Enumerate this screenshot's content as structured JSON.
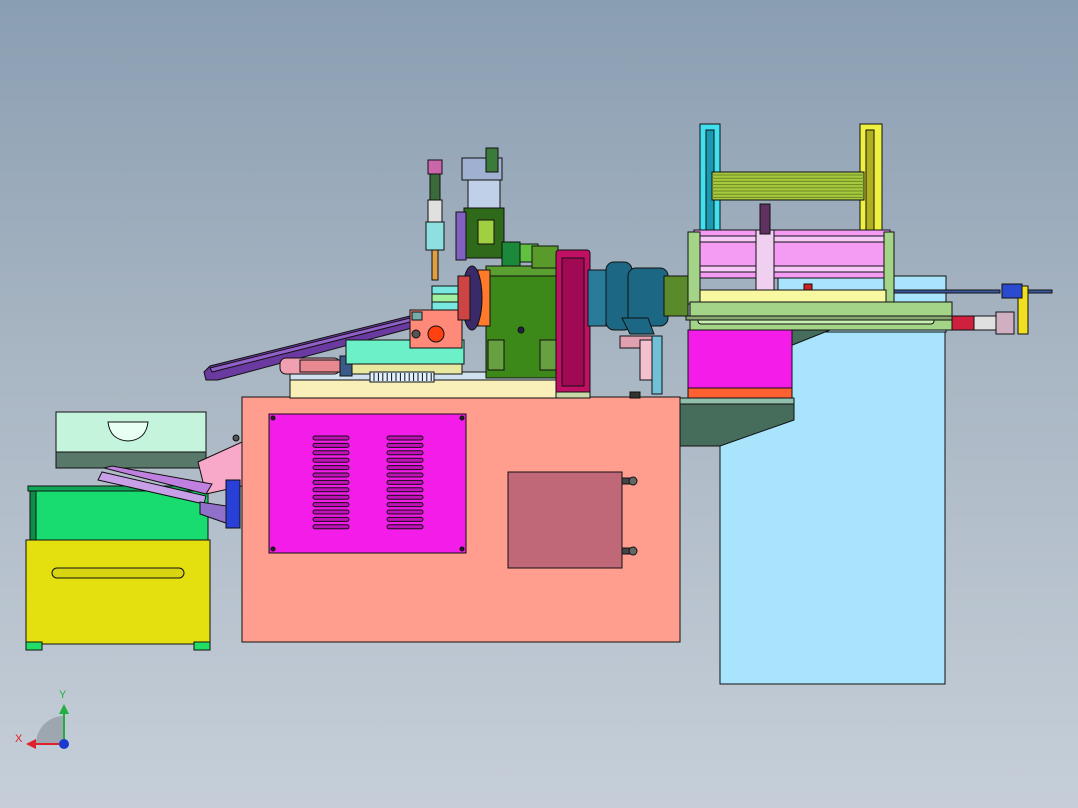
{
  "viewport": {
    "background_top": "#8a9eb2",
    "background_bottom": "#c6cfd9"
  },
  "triad": {
    "x_label": "X",
    "y_label": "Y",
    "x_color": "#e0202a",
    "y_color": "#20b040",
    "z_color": "#1a3ad0"
  },
  "palette": {
    "main_cabinet": "#ff9e8e",
    "vent_panel": "#f41ce8",
    "access_door": "#c06878",
    "side_stand": "#a8e4fc",
    "hopper_tray": "#c4f4dc",
    "hopper_bin": "#18dc70",
    "drawer": "#e4e010",
    "gearbox": "#3c8818",
    "motor": "#1c6884",
    "flywheel": "#c01064",
    "feed_frame": "#a4d488",
    "cylinder_block": "#f49cf4"
  }
}
